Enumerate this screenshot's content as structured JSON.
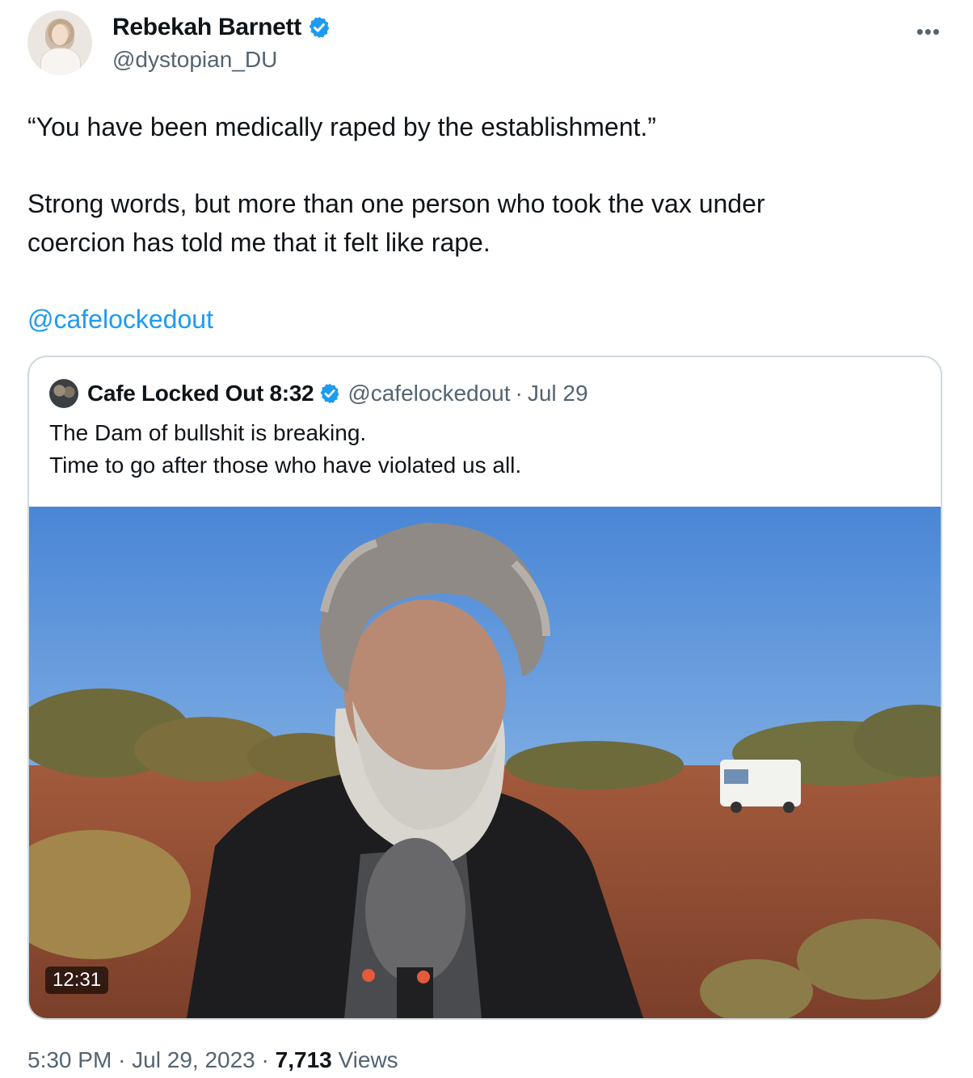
{
  "author": {
    "name": "Rebekah Barnett",
    "handle": "@dystopian_DU",
    "avatar_icon": "profile-photo",
    "verified": true
  },
  "more_icon": "more-horizontal-icon",
  "tweet": {
    "line1": "“You have been medically raped by the establishment.”",
    "line2": "Strong words, but more than one person who took the vax under",
    "line3": "coercion has told me that it felt like rape.",
    "mention": "@cafelockedout"
  },
  "quote": {
    "name": "Cafe Locked Out 8:32",
    "handle": "@cafelockedout",
    "separator": "·",
    "date": "Jul 29",
    "line1": "The Dam of bullshit is breaking.",
    "line2": "Time to go after those who have violated us all.",
    "video_duration": "12:31"
  },
  "footer": {
    "time": "5:30 PM",
    "date": "Jul 29, 2023",
    "separator": "·",
    "views_count": "7,713",
    "views_label": "Views"
  },
  "colors": {
    "accent": "#1d9bf0",
    "text": "#0f1419",
    "secondary": "#536471",
    "border": "#cfd9de"
  }
}
